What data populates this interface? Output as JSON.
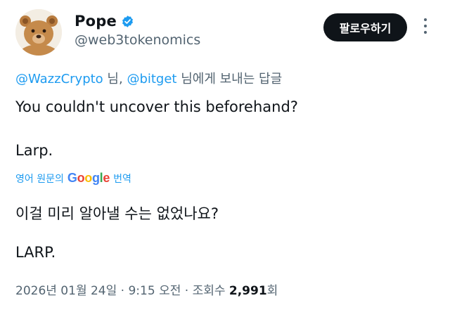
{
  "author": {
    "display_name": "Pope",
    "handle": "@web3tokenomics",
    "verified": true,
    "avatar": "brown-teddy-bear-avatar"
  },
  "follow_button": {
    "label": "팔로우하기"
  },
  "more_button": {
    "icon": "vertical-dots-icon"
  },
  "reply_context": {
    "mention1": "@WazzCrypto",
    "text1": " 님, ",
    "mention2": "@bitget",
    "text2": " 님에게 보내는 답글"
  },
  "tweet": {
    "line1": "You couldn't uncover this beforehand?",
    "line2": "Larp."
  },
  "translation": {
    "prefix": "영어 원문의",
    "suffix": "번역",
    "provider_letters": [
      "G",
      "o",
      "o",
      "g",
      "l",
      "e"
    ],
    "line1": "이걸 미리 알아낼 수는 없었나요?",
    "line2": "LARP."
  },
  "meta": {
    "date": "2026년 01월 24일",
    "sep1": " · ",
    "time": "9:15 오전",
    "sep2": " · ",
    "views_label": "조회수 ",
    "views_count": "2,991",
    "views_unit": "회"
  },
  "colors": {
    "accent": "#1d9bf0",
    "text_primary": "#0f1419",
    "text_secondary": "#536471",
    "button_bg": "#0f1419"
  }
}
